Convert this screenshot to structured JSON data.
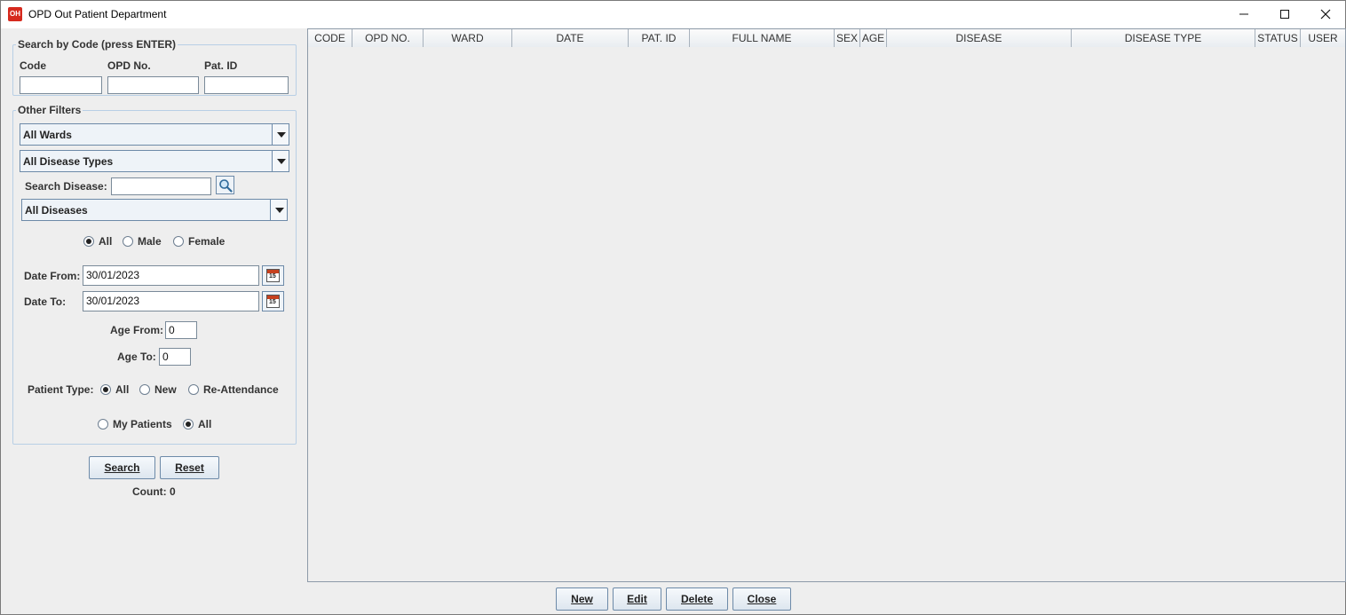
{
  "window": {
    "app_icon_text": "OH",
    "title": "OPD Out Patient Department",
    "controls": [
      "minimize",
      "maximize",
      "close"
    ]
  },
  "search_by_code": {
    "legend": "Search by Code (press ENTER)",
    "code_label": "Code",
    "opd_no_label": "OPD No.",
    "pat_id_label": "Pat. ID",
    "code_value": "",
    "opd_no_value": "",
    "pat_id_value": ""
  },
  "other_filters": {
    "legend": "Other Filters",
    "ward_selected": "All Wards",
    "disease_type_selected": "All Disease Types",
    "search_disease_label": "Search Disease:",
    "search_disease_value": "",
    "disease_selected": "All Diseases",
    "sex_options": [
      "All",
      "Male",
      "Female"
    ],
    "sex_selected": "All",
    "date_from_label": "Date From:",
    "date_from_value": "30/01/2023",
    "date_to_label": "Date To:",
    "date_to_value": "30/01/2023",
    "age_from_label": "Age From:",
    "age_from_value": "0",
    "age_to_label": "Age To:",
    "age_to_value": "0",
    "patient_type_label": "Patient Type:",
    "patient_type_options": [
      "All",
      "New",
      "Re-Attendance"
    ],
    "patient_type_selected": "All",
    "owner_options": [
      "My Patients",
      "All"
    ],
    "owner_selected": "All"
  },
  "actions": {
    "search_label": "Search",
    "reset_label": "Reset",
    "count_text": "Count: 0"
  },
  "table": {
    "columns": [
      "CODE",
      "OPD NO.",
      "WARD",
      "DATE",
      "PAT. ID",
      "FULL NAME",
      "SEX",
      "AGE",
      "DISEASE",
      "DISEASE TYPE",
      "STATUS",
      "USER"
    ],
    "rows": []
  },
  "footer": {
    "new_label": "New",
    "edit_label": "Edit",
    "delete_label": "Delete",
    "close_label": "Close"
  },
  "colors": {
    "app_icon": "#d62a1e",
    "border_accent": "#6d8aa8",
    "panel_bg": "#eeeeee"
  }
}
